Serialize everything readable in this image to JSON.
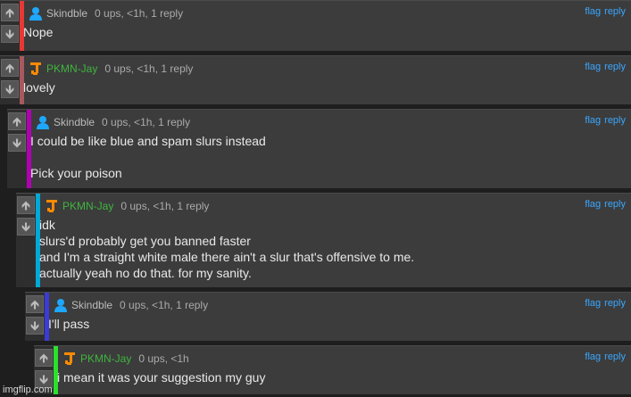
{
  "actions": {
    "flag": "flag",
    "reply": "reply"
  },
  "vote_icons": {
    "up": "arrow-up-icon",
    "down": "arrow-down-icon"
  },
  "colors": {
    "skindble_avatar": "#1ea7ff",
    "jay_avatar": "#ff8a00",
    "stripes": [
      "#e53935",
      "#a8585e",
      "#b100b1",
      "#00a8d8",
      "#3b3bd6",
      "#2ee02e"
    ]
  },
  "comments": [
    {
      "user": "Skindble",
      "meta": "0 ups, <1h, 1 reply",
      "lines": [
        "Nope"
      ]
    },
    {
      "user": "PKMN-Jay",
      "meta": "0 ups, <1h, 1 reply",
      "lines": [
        "lovely"
      ]
    },
    {
      "user": "Skindble",
      "meta": "0 ups, <1h, 1 reply",
      "lines": [
        "I could be like blue and spam slurs instead",
        "",
        "Pick your poison"
      ]
    },
    {
      "user": "PKMN-Jay",
      "meta": "0 ups, <1h, 1 reply",
      "lines": [
        "idk",
        "slurs'd probably get you banned faster",
        "and I'm a straight white male there ain't a slur that's offensive to me.",
        "actually yeah no do that. for my sanity."
      ]
    },
    {
      "user": "Skindble",
      "meta": "0 ups, <1h, 1 reply",
      "lines": [
        "I'll pass"
      ]
    },
    {
      "user": "PKMN-Jay",
      "meta": "0 ups, <1h",
      "lines": [
        "i mean it was your suggestion my guy"
      ]
    }
  ],
  "watermark": "imgflip.com"
}
